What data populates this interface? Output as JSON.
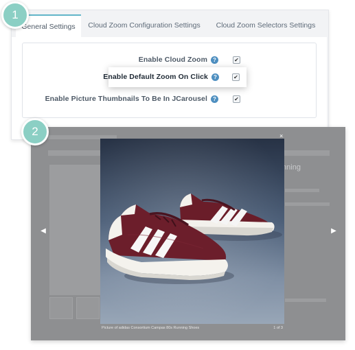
{
  "badges": {
    "one": "1",
    "two": "2"
  },
  "tabs": [
    {
      "label": "General Settings",
      "active": true
    },
    {
      "label": "Cloud Zoom Configuration Settings",
      "active": false
    },
    {
      "label": "Cloud Zoom Selectors Settings",
      "active": false
    }
  ],
  "settings": [
    {
      "label": "Enable Cloud Zoom",
      "checked": true
    },
    {
      "label": "Enable Default Zoom On Click",
      "checked": true,
      "highlighted": true
    },
    {
      "label": "Enable Picture Thumbnails To Be In JCarousel",
      "checked": true
    }
  ],
  "lightbox": {
    "caption": "Picture of adidas Consortium Campas 80s Running Shoes",
    "counter": "1 of 3",
    "close_glyph": "×",
    "prev_glyph": "◀",
    "next_glyph": "▶",
    "background_title": "Running"
  },
  "colors": {
    "badge": "#8bcfc4",
    "active_tab_border": "#61b5c8",
    "help_icon": "#4e8fc0",
    "overlay": "#8e8f91",
    "shoe": "#6b1f2a",
    "photo_background": "#3d4f66"
  }
}
